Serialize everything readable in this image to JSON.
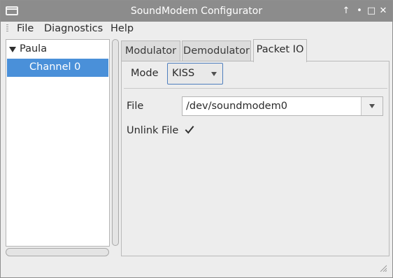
{
  "window": {
    "title": "SoundModem Configurator",
    "controls": [
      "↑",
      "•",
      "□",
      "✕"
    ]
  },
  "menu": {
    "items": [
      "File",
      "Diagnostics",
      "Help"
    ]
  },
  "tree": {
    "root": "Paula",
    "child": "Channel 0"
  },
  "tabs": [
    {
      "label": "Modulator",
      "active": false
    },
    {
      "label": "Demodulator",
      "active": false
    },
    {
      "label": "Packet IO",
      "active": true
    }
  ],
  "packet_io": {
    "mode_label": "Mode",
    "mode_value": "KISS",
    "file_label": "File",
    "file_value": "/dev/soundmodem0",
    "unlink_label": "Unlink File",
    "unlink_checked": true
  },
  "colors": {
    "selection": "#4a90d9",
    "titlebar": "#8c8c8c",
    "focus_border": "#4f7fbe"
  },
  "icons": {
    "window": "window-icon",
    "tree_expander": "expander-down-icon",
    "combo_arrow": "chevron-down-icon",
    "check": "checkmark-icon",
    "resize": "resize-grip-icon"
  }
}
